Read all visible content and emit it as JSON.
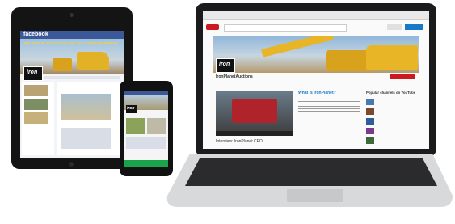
{
  "laptop": {
    "channel_name": "IronPlanetAuctions",
    "video_title": "What is IronPlanet?",
    "video_caption": "Interview: IronPlanet CEO",
    "sidebar_title": "Popular channels on YouTube",
    "logo_text": "iron",
    "colors": {
      "yt_red": "#cc181e",
      "sky": "#8fb6d9",
      "yellow": "#e7b526"
    }
  },
  "tablet": {
    "app_name": "facebook",
    "banner_text": "THE BEST PLACE TO BUY AND SELL USED EQUIPMENT.",
    "logo_text": "iron",
    "colors": {
      "fb_blue": "#3b5998",
      "yellow": "#f2c12e"
    }
  },
  "phone": {
    "logo_text": "iron",
    "colors": {
      "green": "#1aa34a"
    }
  }
}
